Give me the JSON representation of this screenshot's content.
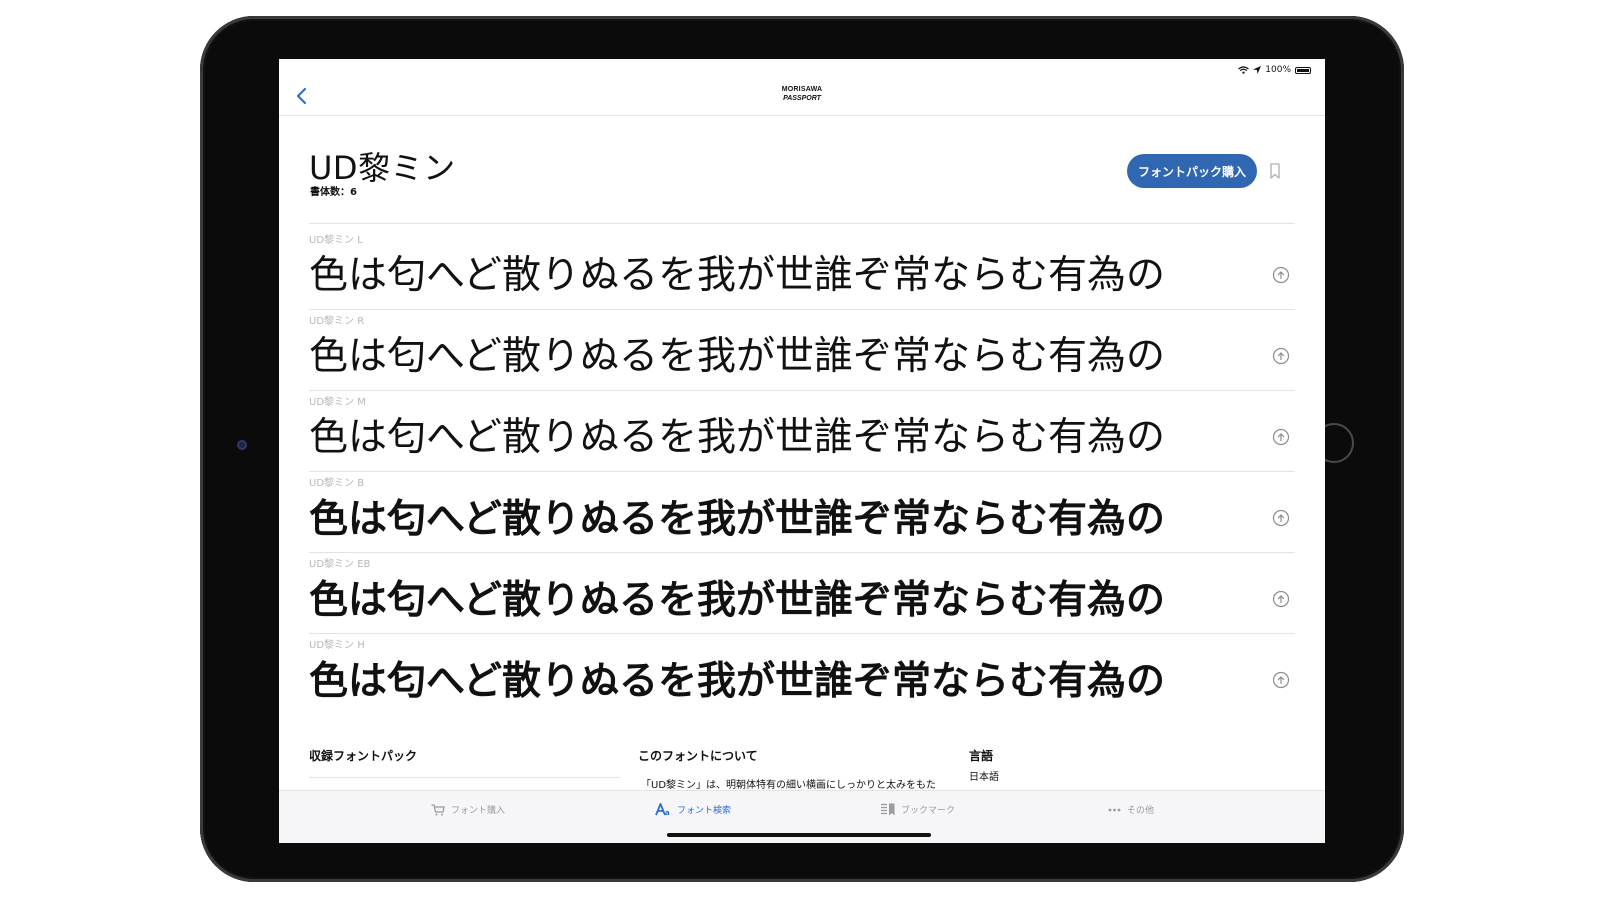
{
  "status_bar": {
    "battery": "100%"
  },
  "navbar": {
    "logo_line1": "MORISAWA",
    "logo_line2": "PASSPORT"
  },
  "header": {
    "title": "UD黎ミン",
    "count": "書体数：6",
    "buy_button": "フォントパック購入"
  },
  "weights": [
    {
      "label": "UD黎ミン L",
      "sample": "色は匂へど散りぬるを我が世誰ぞ常ならむ有為の",
      "weight": 300
    },
    {
      "label": "UD黎ミン R",
      "sample": "色は匂へど散りぬるを我が世誰ぞ常ならむ有為の",
      "weight": 400
    },
    {
      "label": "UD黎ミン M",
      "sample": "色は匂へど散りぬるを我が世誰ぞ常ならむ有為の",
      "weight": 500
    },
    {
      "label": "UD黎ミン B",
      "sample": "色は匂へど散りぬるを我が世誰ぞ常ならむ有為の",
      "weight": 700
    },
    {
      "label": "UD黎ミン EB",
      "sample": "色は匂へど散りぬるを我が世誰ぞ常ならむ有為の",
      "weight": 800
    },
    {
      "label": "UD黎ミン H",
      "sample": "色は匂へど散りぬるを我が世誰ぞ常ならむ有為の",
      "weight": 900
    }
  ],
  "info": {
    "packs_heading": "収録フォントパック",
    "about_heading": "このフォントについて",
    "about_text": "「UD黎ミン」は、明朝体特有の細い横画にしっかりと太みをもた",
    "language_heading": "言語",
    "language_value": "日本語"
  },
  "tabs": [
    {
      "label": "フォント購入",
      "icon": "cart-icon",
      "active": false
    },
    {
      "label": "フォント検索",
      "icon": "font-a-icon",
      "active": true
    },
    {
      "label": "ブックマーク",
      "icon": "bookmark-list-icon",
      "active": false
    },
    {
      "label": "その他",
      "icon": "more-dots-icon",
      "active": false
    }
  ],
  "colors": {
    "accent": "#2f67b3",
    "tab_active": "#2b6fd1",
    "label_gray": "#b7b7bc"
  }
}
